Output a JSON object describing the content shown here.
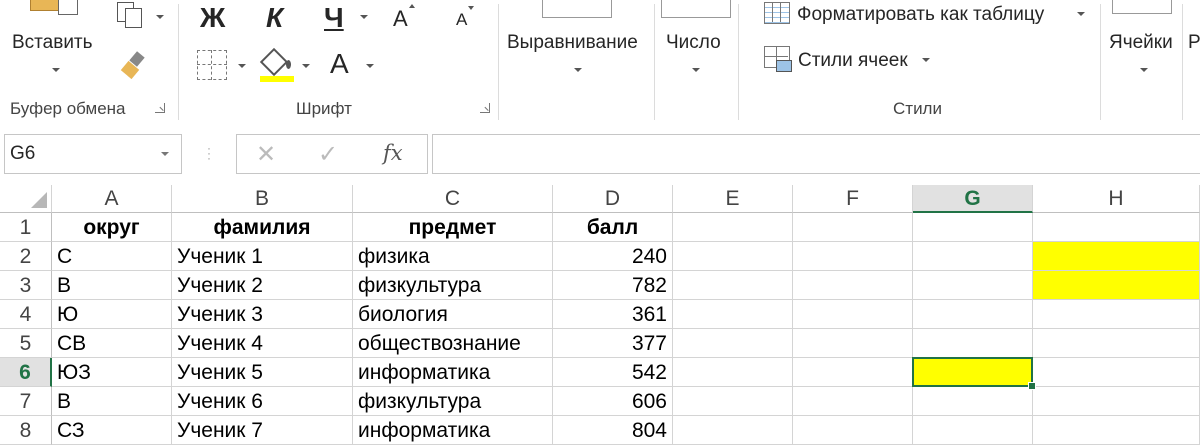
{
  "ribbon": {
    "clipboard": {
      "paste_label": "Вставить",
      "group_label": "Буфер обмена"
    },
    "font": {
      "bold_glyph": "Ж",
      "italic_glyph": "К",
      "underline_glyph": "Ч",
      "grow_glyph": "A",
      "shrink_glyph": "A",
      "fontcolor_glyph": "A",
      "group_label": "Шрифт",
      "fill_color": "#ffff00"
    },
    "alignment_label": "Выравнивание",
    "number_label": "Число",
    "styles": {
      "format_table_label": "Форматировать как таблицу",
      "cell_styles_label": "Стили ячеек",
      "group_label": "Стили"
    },
    "cells_label": "Ячейки",
    "next_partial": "Р"
  },
  "formula_bar": {
    "name_box": "G6",
    "fx": "fx",
    "formula": ""
  },
  "sheet": {
    "columns": [
      "A",
      "B",
      "C",
      "D",
      "E",
      "F",
      "G",
      "H"
    ],
    "rows": [
      "1",
      "2",
      "3",
      "4",
      "5",
      "6",
      "7",
      "8"
    ],
    "selected_column": "G",
    "selected_row": "6",
    "highlight_color": "#ffff00",
    "header": [
      "округ",
      "фамилия",
      "предмет",
      "балл"
    ],
    "data": [
      [
        "С",
        "Ученик 1",
        "физика",
        "240"
      ],
      [
        "В",
        "Ученик 2",
        "физкультура",
        "782"
      ],
      [
        "Ю",
        "Ученик 3",
        "биология",
        "361"
      ],
      [
        "СВ",
        "Ученик 4",
        "обществознание",
        "377"
      ],
      [
        "ЮЗ",
        "Ученик 5",
        "информатика",
        "542"
      ],
      [
        "В",
        "Ученик 6",
        "физкультура",
        "606"
      ],
      [
        "СЗ",
        "Ученик 7",
        "информатика",
        "804"
      ]
    ]
  }
}
